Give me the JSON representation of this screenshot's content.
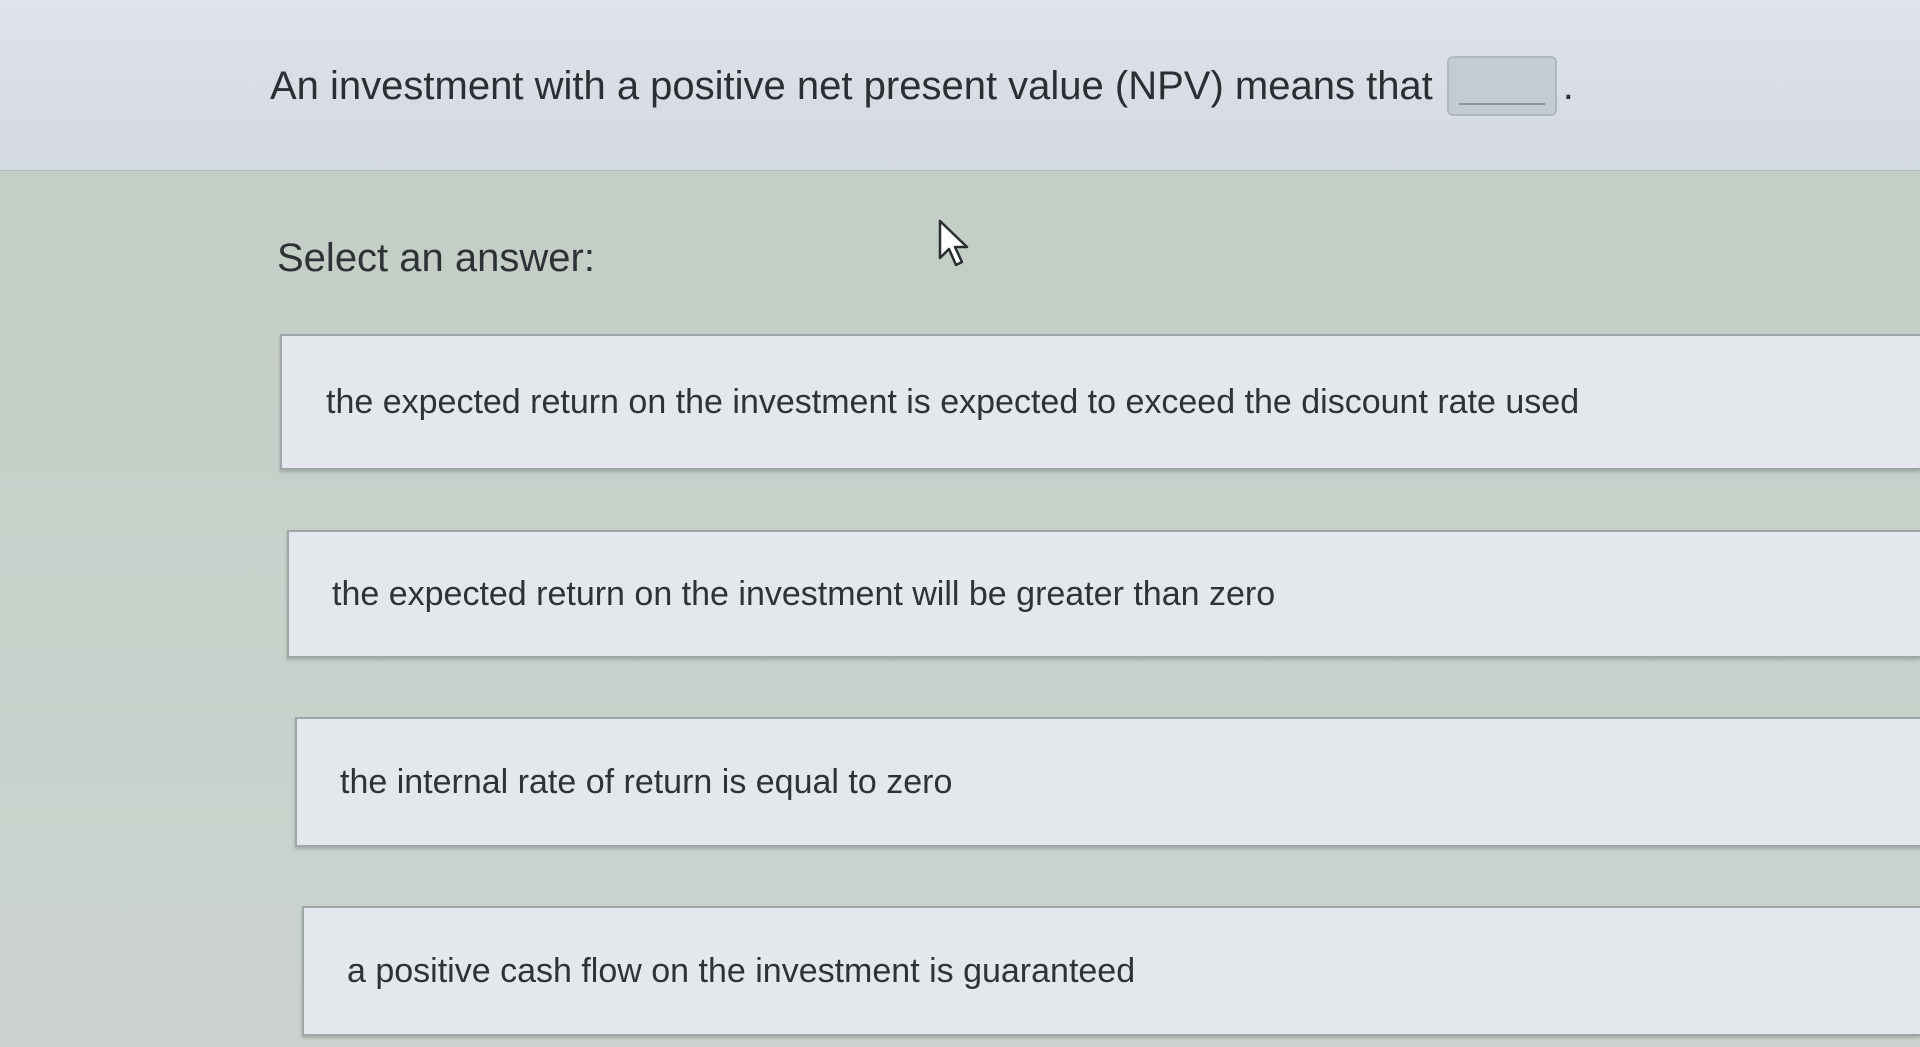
{
  "question": {
    "text": "An investment with a positive net present value (NPV) means that",
    "blank_value": "",
    "trailing_punctuation": "."
  },
  "prompt": "Select an answer:",
  "answers": [
    {
      "label": "the expected return on the investment is expected to exceed the discount rate used"
    },
    {
      "label": "the expected return on the investment will be greater than zero"
    },
    {
      "label": "the internal rate of return is equal to zero"
    },
    {
      "label": "a positive cash flow on the investment is guaranteed"
    }
  ],
  "icons": {
    "cursor": "mouse-pointer-icon"
  },
  "colors": {
    "page_background": "#c6cfc8",
    "question_band": "#d9dde5",
    "answer_background": "#e4e7ec",
    "answer_border": "#9ea6a8",
    "text": "#2e3236"
  }
}
